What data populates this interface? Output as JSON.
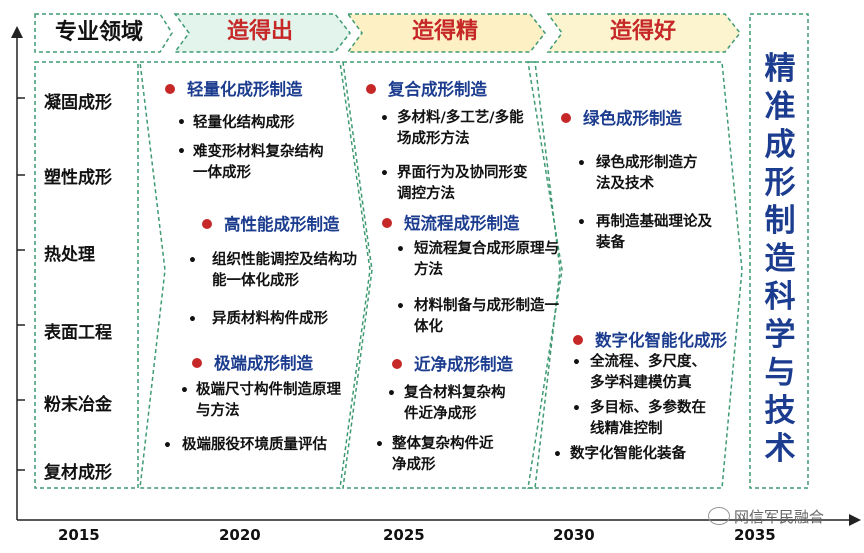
{
  "header": {
    "field_label": "专业领域",
    "stage1": "造得出",
    "stage2": "造得精",
    "stage3": "造得好"
  },
  "colors": {
    "stage1_fill": "#e3f4ec",
    "stage2_fill": "#fdf0c4",
    "stage3_fill": "#fcf4cf",
    "title_blue": "#1c3d8f",
    "stage_red": "#c62828",
    "dot_red": "#c62828",
    "dashed_green": "#3f9a73"
  },
  "fields": [
    "凝固成形",
    "塑性成形",
    "热处理",
    "表面工程",
    "粉末冶金",
    "复材成形"
  ],
  "stage1": {
    "groups": [
      {
        "heading": "轻量化成形制造",
        "items": [
          "轻量化结构成形",
          "难变形材料复杂结构一体成形"
        ]
      },
      {
        "heading": "高性能成形制造",
        "items": [
          "组织性能调控及结构功能一体化成形",
          "异质材料构件成形"
        ]
      },
      {
        "heading": "极端成形制造",
        "items": [
          "极端尺寸构件制造原理与方法",
          "极端服役环境质量评估"
        ]
      }
    ]
  },
  "stage2": {
    "groups": [
      {
        "heading": "复合成形制造",
        "items": [
          "多材料/多工艺/多能场成形方法",
          "界面行为及协同形变调控方法"
        ]
      },
      {
        "heading": "短流程成形制造",
        "items": [
          "短流程复合成形原理与方法",
          "材料制备与成形制造一体化"
        ]
      },
      {
        "heading": "近净成形制造",
        "items": [
          "复合材料复杂构件近净成形",
          "整体复杂构件近净成形"
        ]
      }
    ]
  },
  "stage3": {
    "groups": [
      {
        "heading": "绿色成形制造",
        "items": [
          "绿色成形制造方法及技术",
          "再制造基础理论及装备"
        ]
      },
      {
        "heading": "数字化智能化成形",
        "items": [
          "全流程、多尺度、多学科建模仿真",
          "多目标、多参数在线精准控制",
          "数字化智能化装备"
        ]
      }
    ]
  },
  "goal_title": "精准成形制造科学与技术",
  "years": [
    "2015",
    "2020",
    "2025",
    "2030",
    "2035"
  ],
  "watermark": "网信军民融合"
}
